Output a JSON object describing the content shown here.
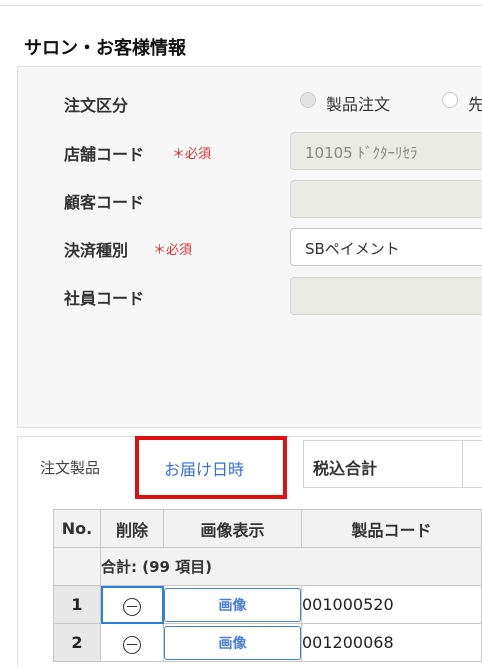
{
  "section": {
    "title": "サロン・お客様情報"
  },
  "form": {
    "order_type": {
      "label": "注文区分",
      "option1": "製品注文",
      "option2": "先"
    },
    "store_code": {
      "label": "店舗コード",
      "required": "＊必須",
      "value": "10105 ﾄﾞｸﾀｰﾘｾﾗ"
    },
    "customer_code": {
      "label": "顧客コード",
      "value": ""
    },
    "payment_type": {
      "label": "決済種別",
      "required": "＊必須",
      "value": "SBペイメント"
    },
    "employee_code": {
      "label": "社員コード",
      "value": ""
    }
  },
  "tabs": {
    "order_products": "注文製品",
    "delivery_date": "お届け日時",
    "tax_total": "税込合計"
  },
  "highlight_color": "#e01010",
  "table": {
    "headers": {
      "no": "No.",
      "delete": "削除",
      "image": "画像表示",
      "code": "製品コード"
    },
    "summary": "合計: (99 項目)",
    "rows": [
      {
        "no": "1",
        "image_label": "画像",
        "code": "001000520"
      },
      {
        "no": "2",
        "image_label": "画像",
        "code": "001200068"
      }
    ]
  }
}
